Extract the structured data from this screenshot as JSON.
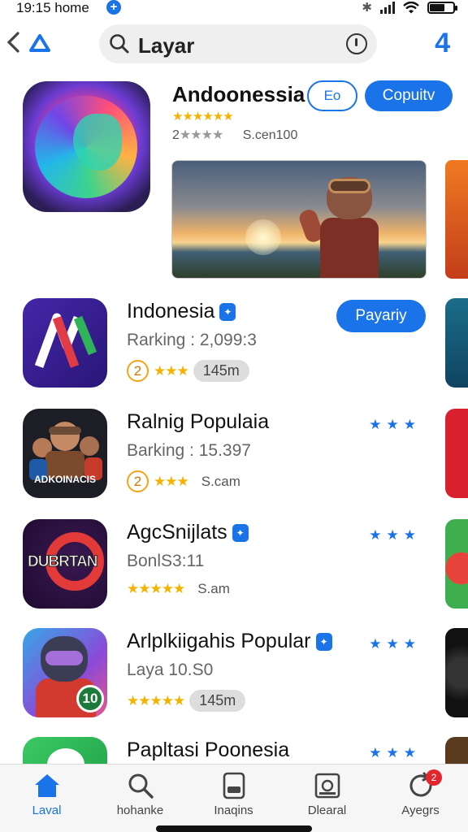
{
  "status": {
    "time": "19:15 home",
    "plus": "+"
  },
  "search": {
    "query": "Layar"
  },
  "header": {
    "right_glyph": "4"
  },
  "featured": {
    "name": "Andoonessia",
    "camera_label": "Eo",
    "get_label": "Copuitv",
    "stars": "★★★★★★",
    "rating_prefix": "2",
    "rating_stars": "★★★★",
    "size": "S.cen100"
  },
  "apps": [
    {
      "title": "Indonesia",
      "sub": "Rarking : 2,099:3",
      "rank": "2",
      "stars": "★★★",
      "size": "145m",
      "action": "Payariy"
    },
    {
      "title": "Ralnig Populaia",
      "sub": "Barking : 15.397",
      "rank": "2",
      "stars": "★★★",
      "size": "S.cam",
      "icon_text": "ADKOINACIS"
    },
    {
      "title": "AgcSnijlats",
      "sub": "BonlS3:11",
      "stars": "★★★★★",
      "size": "S.am",
      "icon_text": "DUBRTAN"
    },
    {
      "title": "Arlplkiigahis Popular",
      "sub": "Laya 10.S0",
      "stars": "★★★★★",
      "size": "145m",
      "badge": "10"
    },
    {
      "title": "Papltasi Poonesia"
    }
  ],
  "row_stars_blue": "★★★",
  "nav": {
    "tabs": [
      {
        "label": "Laval",
        "icon": "home-icon"
      },
      {
        "label": "hohanke",
        "icon": "search-icon"
      },
      {
        "label": "Inaqins",
        "icon": "tablet-icon"
      },
      {
        "label": "Dlearal",
        "icon": "gallery-icon"
      },
      {
        "label": "Ayegrs",
        "icon": "updates-icon",
        "badge": "2"
      }
    ]
  },
  "colors": {
    "accent": "#1a73e8",
    "star": "#f3b300",
    "badge_red": "#e3262e"
  }
}
